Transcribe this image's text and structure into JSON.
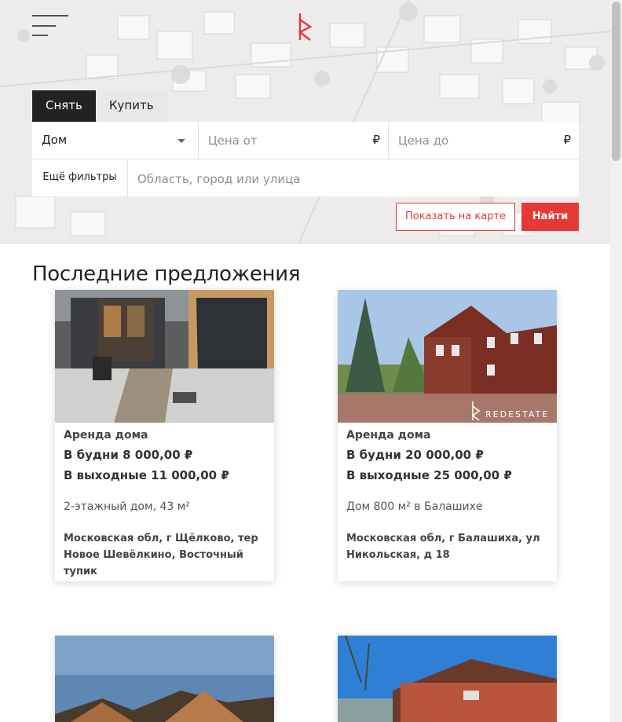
{
  "header": {
    "menu_icon": "hamburger-menu-icon",
    "logo_icon": "red-estate-logo"
  },
  "search": {
    "tabs": [
      {
        "label": "Снять",
        "active": true
      },
      {
        "label": "Купить",
        "active": false
      }
    ],
    "property_type": "Дом",
    "price_from_placeholder": "Цена от",
    "price_to_placeholder": "Цена до",
    "currency": "₽",
    "more_filters_label": "Ещё фильтры",
    "location_placeholder": "Область, город или улица",
    "show_on_map_label": "Показать на карте",
    "find_label": "Найти"
  },
  "listings": {
    "title": "Последние предложения",
    "items": [
      {
        "kind": "Аренда дома",
        "weekday_price": "В будни 8 000,00 ₽",
        "weekend_price": "В выходные 11 000,00 ₽",
        "description": "2-этажный дом, 43 м²",
        "address_line1": "Московская обл, г Щёлково, тер",
        "address_line2": "Новое Шевёлкино, Восточный тупик"
      },
      {
        "kind": "Аренда дома",
        "weekday_price": "В будни 20 000,00 ₽",
        "weekend_price": "В выходные 25 000,00 ₽",
        "description": "Дом 800 м² в Балашихе",
        "address_line1": "Московская обл, г Балашиха, ул",
        "address_line2": "Никольская, д 18",
        "watermark": "REDESTATE"
      }
    ]
  },
  "colors": {
    "accent": "#e53935",
    "dark_tab": "#222222"
  }
}
